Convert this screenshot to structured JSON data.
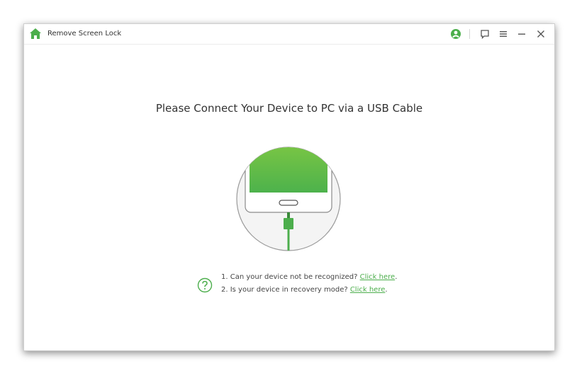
{
  "window": {
    "title": "Remove Screen Lock"
  },
  "titlebar": {
    "icons": [
      "home-icon",
      "account-icon",
      "feedback-icon",
      "menu-icon",
      "minimize-icon",
      "close-icon"
    ]
  },
  "main": {
    "headline": "Please Connect Your Device to PC via a USB Cable",
    "illustration": "phone-usb-connection"
  },
  "help": {
    "icon": "question-icon",
    "items": [
      {
        "text": "1. Can your device not be recognized? ",
        "link": "Click here",
        "suffix": "."
      },
      {
        "text": "2. Is your device in recovery mode? ",
        "link": "Click here",
        "suffix": "."
      }
    ]
  },
  "colors": {
    "accent": "#4cae4c",
    "screen_top": "#7fc843",
    "screen_bottom": "#4db24c",
    "text": "#333333",
    "circle_border": "#9a9a9a"
  }
}
